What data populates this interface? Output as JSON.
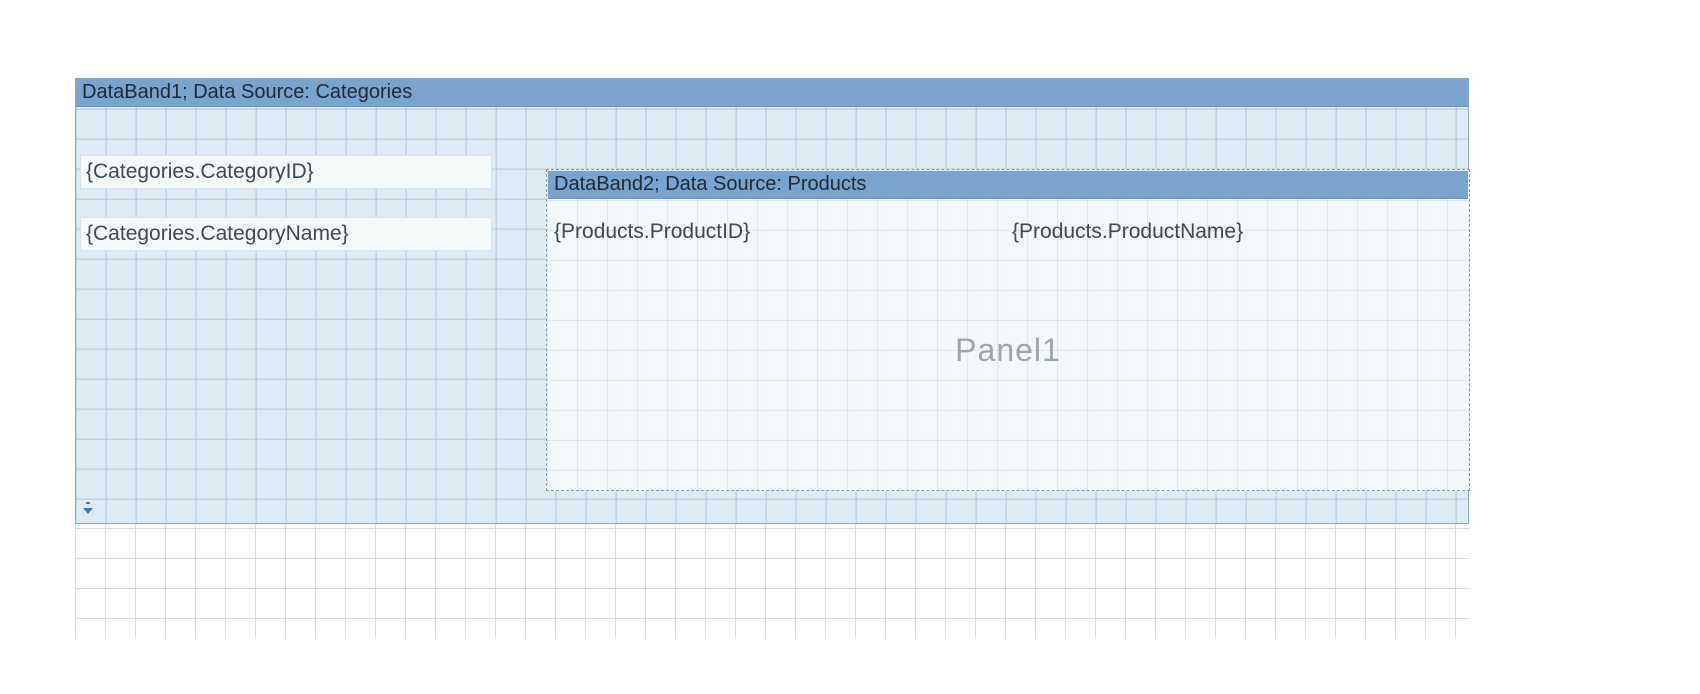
{
  "band1": {
    "header": "DataBand1; Data Source: Categories",
    "fields": {
      "categoryId": "{Categories.CategoryID}",
      "categoryName": "{Categories.CategoryName}"
    }
  },
  "panel1": {
    "watermark": "Panel1",
    "band2": {
      "header": "DataBand2; Data Source: Products",
      "fields": {
        "productId": "{Products.ProductID}",
        "productName": "{Products.ProductName}"
      }
    }
  }
}
